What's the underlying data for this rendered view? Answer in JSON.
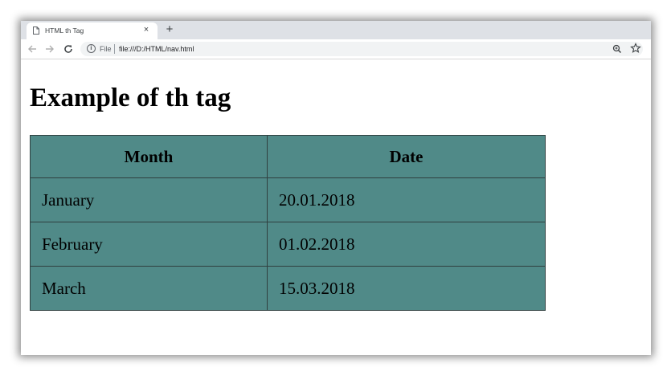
{
  "browser": {
    "tab_title": "HTML th Tag",
    "new_tab_symbol": "+",
    "close_symbol": "×",
    "address_scheme": "File",
    "url": "file:///D:/HTML/nav.html",
    "icons": {
      "tab": "document-icon",
      "back": "back-arrow-icon",
      "forward": "forward-arrow-icon",
      "reload": "reload-icon",
      "info": "info-icon",
      "zoom": "zoom-icon",
      "bookmark": "star-icon"
    }
  },
  "page": {
    "heading": "Example of th tag",
    "table": {
      "headers": [
        "Month",
        "Date"
      ],
      "rows": [
        [
          "January",
          "20.01.2018"
        ],
        [
          "February",
          "01.02.2018"
        ],
        [
          "March",
          "15.03.2018"
        ]
      ],
      "background_color": "#508a88"
    }
  }
}
